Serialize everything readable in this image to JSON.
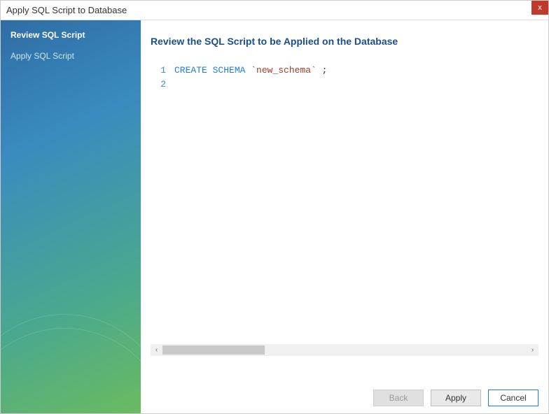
{
  "window": {
    "title": "Apply SQL Script to Database",
    "close_label": "x"
  },
  "sidebar": {
    "items": [
      {
        "label": "Review SQL Script",
        "active": true
      },
      {
        "label": "Apply SQL Script",
        "active": false
      }
    ]
  },
  "main": {
    "heading": "Review the SQL Script to be Applied on the Database"
  },
  "code": {
    "lines": [
      {
        "num": "1",
        "tokens": [
          {
            "cls": "tok-keyword",
            "text": "CREATE SCHEMA"
          },
          {
            "cls": "tok-default",
            "text": " "
          },
          {
            "cls": "tok-string",
            "text": "`new_schema`"
          },
          {
            "cls": "tok-default",
            "text": " ;"
          }
        ]
      },
      {
        "num": "2",
        "tokens": []
      }
    ]
  },
  "scrollbar": {
    "left_arrow": "‹",
    "right_arrow": "›"
  },
  "buttons": {
    "back": "Back",
    "apply": "Apply",
    "cancel": "Cancel"
  }
}
